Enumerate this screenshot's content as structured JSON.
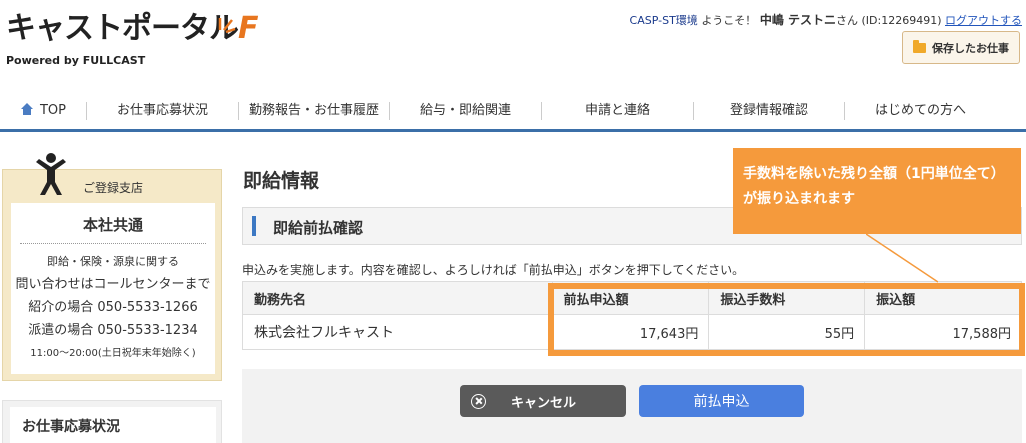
{
  "header": {
    "logo_text": "キャストポータル",
    "logo_suffix": "F",
    "logo_powered_prefix": "Powered by ",
    "logo_powered_brand": "FULLCAST",
    "env_label": "CASP-ST環境",
    "welcome": "ようこそ！",
    "user_name": "中嶋 テストニ",
    "user_suffix": "さん",
    "user_id": "(ID:12269491)",
    "logout_label": "ログアウトする",
    "saved_jobs_label": "保存したお仕事"
  },
  "nav": {
    "items": [
      {
        "label": "TOP"
      },
      {
        "label": "お仕事応募状況"
      },
      {
        "label": "勤務報告・お仕事履歴"
      },
      {
        "label": "給与・即給関連"
      },
      {
        "label": "申請と連絡"
      },
      {
        "label": "登録情報確認"
      },
      {
        "label": "はじめての方へ"
      }
    ]
  },
  "sidebar": {
    "branch_title": "ご登録支店",
    "branch_name": "本社共通",
    "lines": [
      "即給・保険・源泉に関する",
      "問い合わせはコールセンターまで",
      "紹介の場合 050-5533-1266",
      "派遣の場合 050-5533-1234",
      "11:00～20:00(土日祝年末年始除く)"
    ],
    "status_title": "お仕事応募状況"
  },
  "main": {
    "page_title": "即給情報",
    "section_title": "即給前払確認",
    "description": "申込みを実施します。内容を確認し、よろしければ「前払申込」ボタンを押下してください。",
    "table": {
      "headers": [
        "勤務先名",
        "前払申込額",
        "振込手数料",
        "振込額"
      ],
      "rows": [
        [
          "株式会社フルキャスト",
          "17,643円",
          "55円",
          "17,588円"
        ]
      ]
    },
    "cancel_label": "キャンセル",
    "submit_label": "前払申込"
  },
  "annotation": {
    "text": "手数料を除いた残り全額（1円単位全て）が振り込まれます",
    "color": "#f59a3c"
  },
  "colors": {
    "accent_blue": "#3b6fa8",
    "submit_blue": "#4a7fdf",
    "sidebar_beige": "#f5e9c8",
    "logo_orange": "#e8761f"
  }
}
